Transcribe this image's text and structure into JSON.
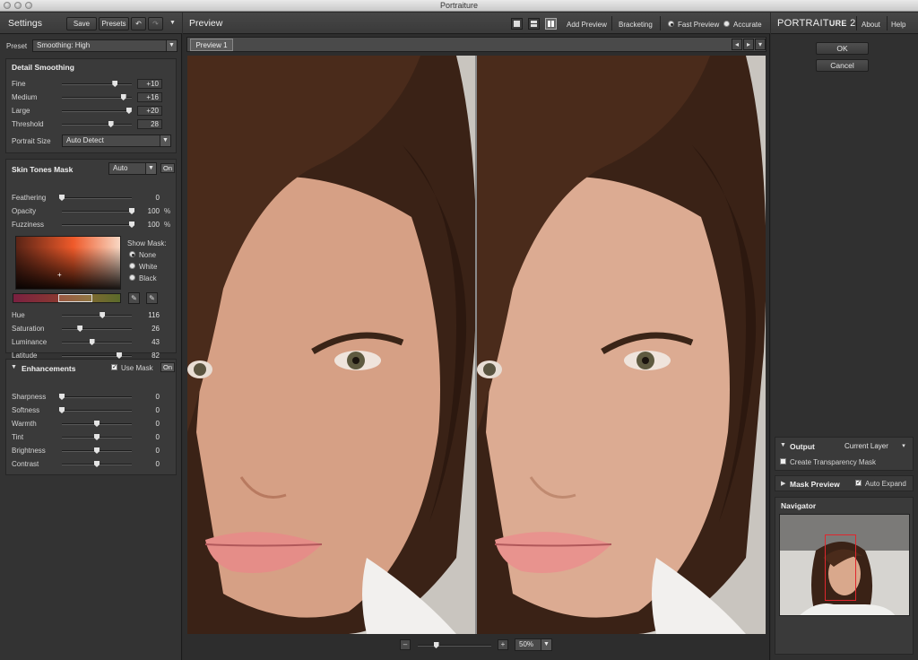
{
  "window": {
    "title": "Portraiture"
  },
  "settings": {
    "title": "Settings",
    "save_label": "Save",
    "presets_label": "Presets",
    "undo_icon": "undo-icon",
    "redo_icon": "redo-icon",
    "preset_label": "Preset",
    "preset_value": "Smoothing: High"
  },
  "detail": {
    "title": "Detail Smoothing",
    "sliders": [
      {
        "label": "Fine",
        "value": "+10",
        "pos": 0.76
      },
      {
        "label": "Medium",
        "value": "+16",
        "pos": 0.88
      },
      {
        "label": "Large",
        "value": "+20",
        "pos": 0.96
      },
      {
        "label": "Threshold",
        "value": "28",
        "pos": 0.7
      }
    ],
    "portrait_size_label": "Portrait Size",
    "portrait_size_value": "Auto Detect"
  },
  "skin": {
    "title": "Skin Tones Mask",
    "mode": "Auto",
    "on_label": "On",
    "sliders": [
      {
        "label": "Feathering",
        "value": "0",
        "pos": 0.0,
        "unit": ""
      },
      {
        "label": "Opacity",
        "value": "100",
        "pos": 1.0,
        "unit": "%"
      },
      {
        "label": "Fuzziness",
        "value": "100",
        "pos": 1.0,
        "unit": "%"
      }
    ],
    "show_mask_label": "Show Mask:",
    "mask_options": [
      "None",
      "White",
      "Black"
    ],
    "mask_selected": "None",
    "color_sliders": [
      {
        "label": "Hue",
        "value": "116",
        "pos": 0.58
      },
      {
        "label": "Saturation",
        "value": "26",
        "pos": 0.26
      },
      {
        "label": "Luminance",
        "value": "43",
        "pos": 0.43
      },
      {
        "label": "Latitude",
        "value": "82",
        "pos": 0.82
      }
    ]
  },
  "enhance": {
    "title": "Enhancements",
    "use_mask_label": "Use Mask",
    "on_label": "On",
    "sliders": [
      {
        "label": "Sharpness",
        "value": "0",
        "pos": 0.0
      },
      {
        "label": "Softness",
        "value": "0",
        "pos": 0.0
      },
      {
        "label": "Warmth",
        "value": "0",
        "pos": 0.5
      },
      {
        "label": "Tint",
        "value": "0",
        "pos": 0.5
      },
      {
        "label": "Brightness",
        "value": "0",
        "pos": 0.5
      },
      {
        "label": "Contrast",
        "value": "0",
        "pos": 0.5
      }
    ]
  },
  "preview": {
    "title": "Preview",
    "add_preview_label": "Add Preview",
    "bracketing_label": "Bracketing",
    "fast_preview_label": "Fast Preview",
    "accurate_label": "Accurate",
    "tab_label": "Preview 1",
    "zoom_value": "50%",
    "zoom_pos": 0.25
  },
  "right": {
    "brand_a": "Portrait",
    "brand_b": "ure",
    "brand_ver": "2",
    "about_label": "About",
    "help_label": "Help",
    "ok_label": "OK",
    "cancel_label": "Cancel",
    "output_label": "Output",
    "output_value": "Current Layer",
    "transparency_label": "Create Transparency Mask",
    "mask_preview_label": "Mask Preview",
    "auto_expand_label": "Auto Expand",
    "navigator_label": "Navigator"
  },
  "colors": {
    "panel": "#333333",
    "face_skin": "#d9a88c",
    "hair": "#3b2418",
    "navigator_frame": "#e0262d"
  }
}
